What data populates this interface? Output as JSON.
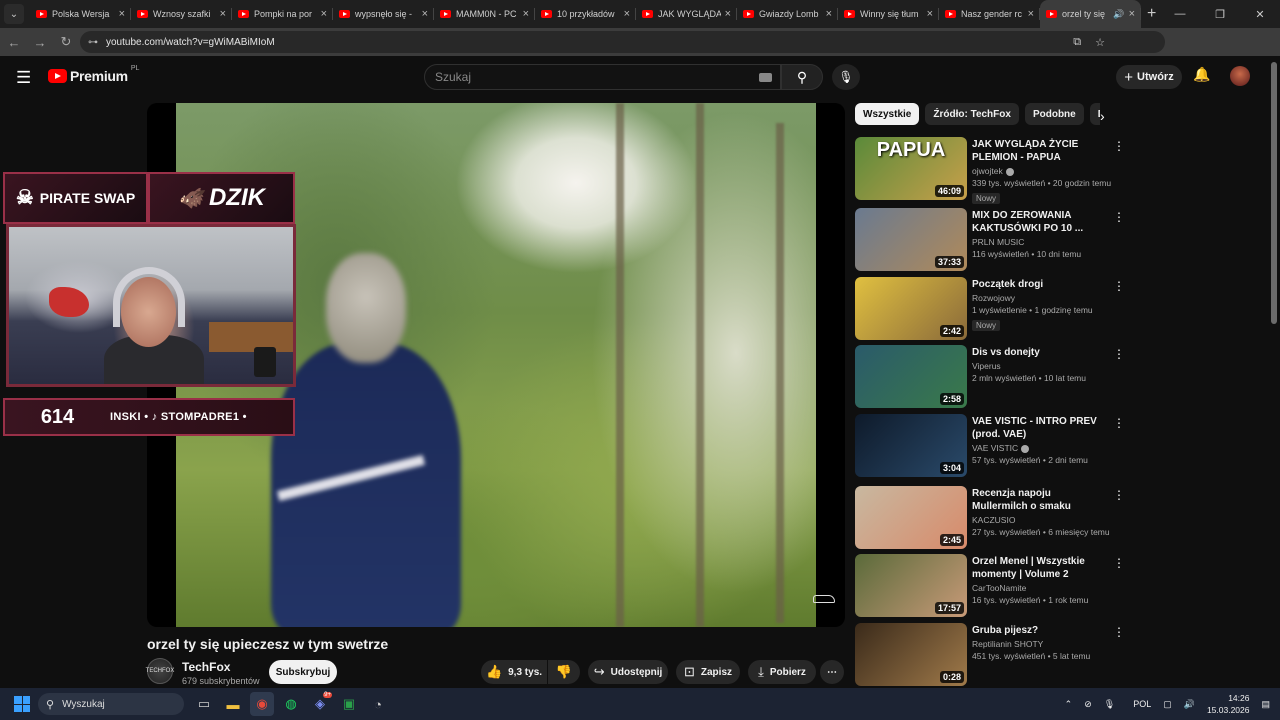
{
  "browser": {
    "tabs": [
      {
        "title": "Polska Wersja"
      },
      {
        "title": "Wznosy szafki"
      },
      {
        "title": "Pompki na por"
      },
      {
        "title": "wypsnęło się -"
      },
      {
        "title": "MAMM0N - PC"
      },
      {
        "title": "10 przykładów"
      },
      {
        "title": "JAK WYGLĄDA"
      },
      {
        "title": "Gwiazdy Lomb"
      },
      {
        "title": "Winny się tłum"
      },
      {
        "title": "Nasz gender rc"
      },
      {
        "title": "orzel ty się"
      }
    ],
    "url": "youtube.com/watch?v=gWiMABiMIoM"
  },
  "header": {
    "logo_text": "Premium",
    "country": "PL",
    "search_placeholder": "Szukaj",
    "create_label": "Utwórz"
  },
  "video": {
    "title": "orzel ty się upieczesz w tym swetrze",
    "overlay": {
      "sponsor1": "PIRATE SWAP",
      "sponsor2": "DZIK",
      "counter": "614",
      "ticker": "INSKI • ♪ STOMPADRE1 •"
    },
    "channel": {
      "name": "TechFox",
      "subs": "679 subskrybentów",
      "avatar_text": "TECHFOX"
    },
    "subscribe_label": "Subskrybuj",
    "likes": "9,3 tys.",
    "share_label": "Udostępnij",
    "save_label": "Zapisz",
    "download_label": "Pobierz"
  },
  "sidebar": {
    "chips": [
      "Wszystkie",
      "Źródło: TechFox",
      "Podobne",
      "Dla"
    ],
    "recommendations": [
      {
        "title": "JAK WYGLĄDA ŻYCIE PLEMION - PAPUA",
        "channel": "ojwojtek",
        "verified": true,
        "meta": "339 tys. wyświetleń • 20 godzin temu",
        "badge": "Nowy",
        "duration": "46:09",
        "thumb_text": "PAPUA",
        "thumb_colors": [
          "#5a8a3a",
          "#c8a04a"
        ]
      },
      {
        "title": "MIX DO ZEROWANIA KAKTUSÓWKI PO 10 ...",
        "channel": "PRLN MUSIC",
        "verified": false,
        "meta": "116 wyświetleń • 10 dni temu",
        "badge": "",
        "duration": "37:33",
        "thumb_text": "",
        "thumb_colors": [
          "#6a7a90",
          "#b08a5a"
        ]
      },
      {
        "title": "Początek drogi",
        "channel": "Rozwojowy",
        "verified": false,
        "meta": "1 wyświetlenie • 1 godzinę temu",
        "badge": "Nowy",
        "duration": "2:42",
        "thumb_text": "",
        "thumb_colors": [
          "#e0c040",
          "#8a6a3a"
        ]
      },
      {
        "title": "Dis vs donejty",
        "channel": "Viperus",
        "verified": false,
        "meta": "2 mln wyświetleń • 10 lat temu",
        "badge": "",
        "duration": "2:58",
        "thumb_text": "",
        "thumb_colors": [
          "#2a5a6a",
          "#3a7a4a"
        ]
      },
      {
        "title": "VAE VISTIC - INTRO PREV (prod. VAE)",
        "channel": "VAE VISTIC",
        "verified": true,
        "meta": "57 tys. wyświetleń • 2 dni temu",
        "badge": "",
        "duration": "3:04",
        "thumb_text": "",
        "thumb_colors": [
          "#0e1a2a",
          "#2a4a6a"
        ]
      },
      {
        "title": "Recenzja napoju Mullermilch o smaku anielskich włosach ...",
        "channel": "KACZUSIO",
        "verified": false,
        "meta": "27 tys. wyświetleń • 6 miesięcy temu",
        "badge": "",
        "duration": "2:45",
        "thumb_text": "",
        "thumb_colors": [
          "#c8b8a0",
          "#d88a6a"
        ]
      },
      {
        "title": "Orzel Menel | Wszystkie momenty | Volume 2",
        "channel": "CarTooNamite",
        "verified": false,
        "meta": "16 tys. wyświetleń • 1 rok temu",
        "badge": "",
        "duration": "17:57",
        "thumb_text": "",
        "thumb_colors": [
          "#5a6a3a",
          "#c89a78"
        ]
      },
      {
        "title": "Gruba pijesz?",
        "channel": "Reptilianin SHOTY",
        "verified": false,
        "meta": "451 tys. wyświetleń • 5 lat temu",
        "badge": "",
        "duration": "0:28",
        "thumb_text": "",
        "thumb_colors": [
          "#3a2a1a",
          "#a07a4a"
        ]
      }
    ]
  },
  "taskbar": {
    "search_placeholder": "Wyszukaj",
    "discord_badge": "9+",
    "language": "POL",
    "time": "14:26",
    "date": "15.03.2026"
  }
}
